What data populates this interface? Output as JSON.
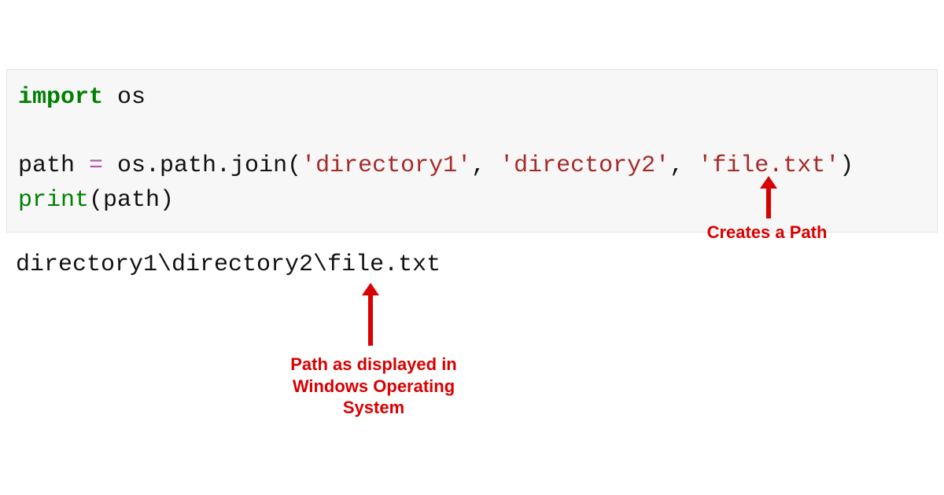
{
  "code": {
    "line1_kw": "import",
    "line1_mod": " os",
    "line3_var": "path ",
    "line3_op": "=",
    "line3_call": " os.path.join(",
    "line3_str1": "'directory1'",
    "line3_comma1": ", ",
    "line3_str2": "'directory2'",
    "line3_comma2": ", ",
    "line3_str3": "'file.txt'",
    "line3_close": ")",
    "line4_fn": "print",
    "line4_open": "(path)"
  },
  "output": "directory1\\directory2\\file.txt",
  "annotations": {
    "creates": "Creates a Path",
    "displayed": "Path as displayed in\nWindows Operating\nSystem"
  }
}
